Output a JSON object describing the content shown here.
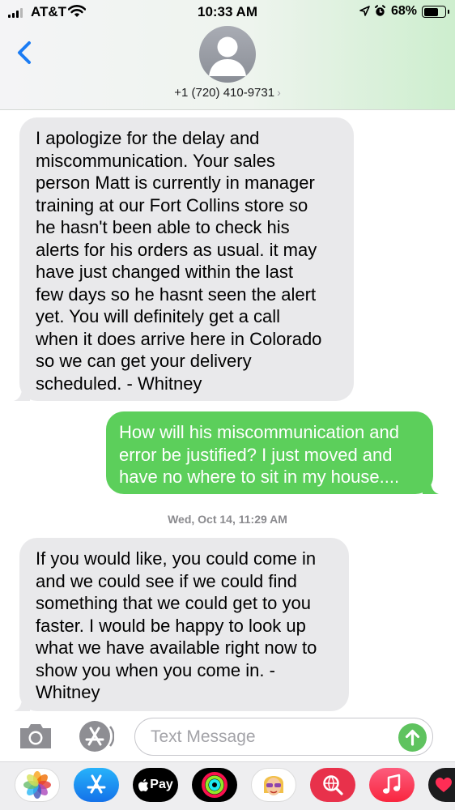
{
  "status_bar": {
    "carrier": "AT&T",
    "time": "10:33 AM",
    "battery_percent": "68%",
    "battery_level": 0.68,
    "icons": [
      "signal-bars-icon",
      "wifi-icon",
      "location-arrow-icon",
      "alarm-clock-icon",
      "battery-icon"
    ]
  },
  "header": {
    "back_icon": "chevron-left-icon",
    "avatar_icon": "person-silhouette-icon",
    "contact_number": "+1 (720) 410-9731",
    "contact_chevron": "›"
  },
  "thread": {
    "messages": [
      {
        "direction": "received",
        "lines": [
          "I apologize for the delay and",
          "miscommunication. Your sales",
          "person Matt is currently in manager",
          "training at our Fort Collins store so",
          "he hasn't been able to check his",
          "alerts for his orders as usual. it may",
          "have just changed within the last",
          "few days so he hasnt seen the alert",
          "yet. You will definitely get a call",
          "when it does arrive here in Colorado",
          "so we can get your delivery",
          "scheduled. - Whitney"
        ]
      },
      {
        "direction": "sent",
        "lines": [
          "How will his miscommunication and",
          "error be justified? I just moved and",
          "have no where to sit in my house...."
        ]
      },
      {
        "direction": "received",
        "lines": [
          "If you would like, you could come in",
          "and we could see if we could find",
          "something that we could get to you",
          "faster. I would be happy to look up",
          "what we have available right now to",
          "show you when you come in. -",
          "Whitney"
        ]
      }
    ],
    "timestamp": "Wed, Oct 14, 11:29 AM"
  },
  "input_bar": {
    "camera_icon": "camera-icon",
    "appstore_icon": "app-store-icon",
    "placeholder": "Text Message",
    "send_icon": "arrow-up-icon"
  },
  "app_drawer": {
    "apps": [
      {
        "name": "photos",
        "icon": "photos-pinwheel-icon"
      },
      {
        "name": "app-store",
        "icon": "app-store-icon"
      },
      {
        "name": "apple-pay",
        "label": "Pay",
        "icon": "apple-logo-icon"
      },
      {
        "name": "activity",
        "icon": "activity-rings-icon"
      },
      {
        "name": "memoji",
        "icon": "memoji-face-icon"
      },
      {
        "name": "web-search",
        "icon": "globe-search-icon"
      },
      {
        "name": "music",
        "icon": "music-note-icon"
      },
      {
        "name": "digital-touch",
        "icon": "heart-icon"
      }
    ]
  },
  "colors": {
    "sent_bubble": "#5ccf5b",
    "received_bubble": "#e9e9eb",
    "ios_blue": "#1b7cf4",
    "send_button": "#5fc35f"
  }
}
